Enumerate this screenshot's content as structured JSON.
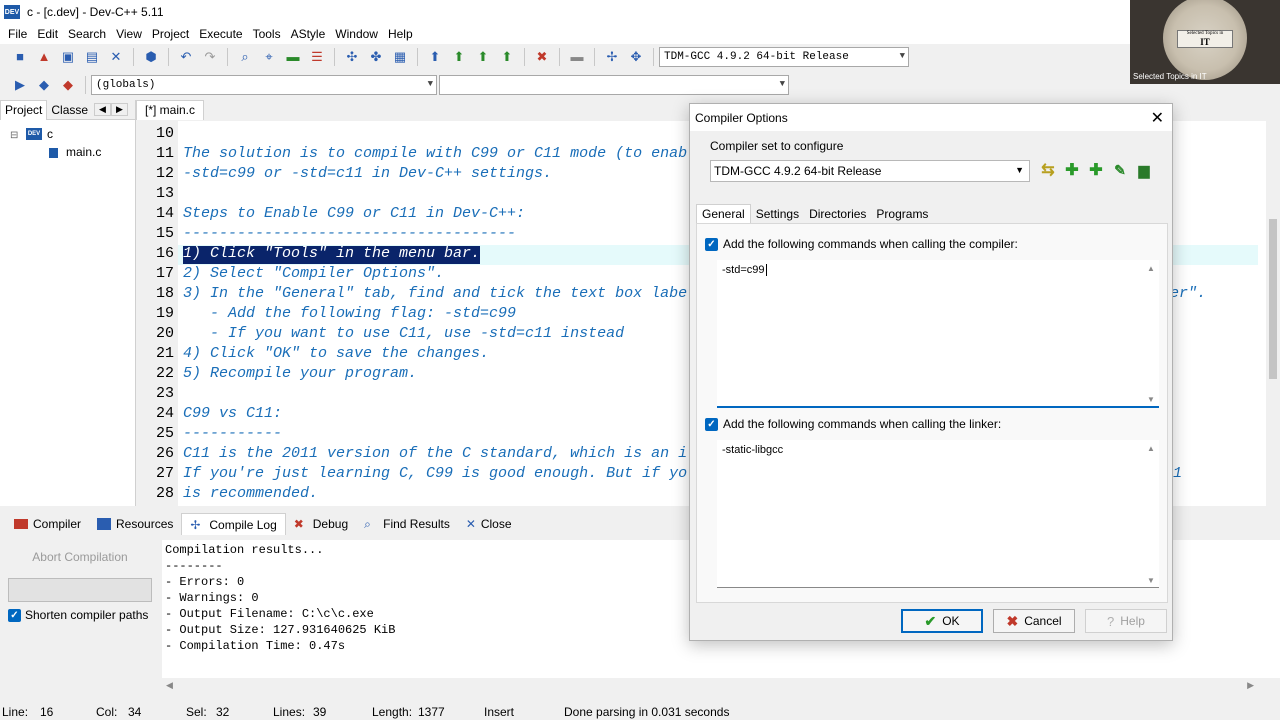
{
  "window": {
    "title": "c - [c.dev] - Dev-C++ 5.11",
    "app_icon_text": "DEV"
  },
  "webcam": {
    "banner_top": "Selected Topics in",
    "banner_main": "IT",
    "caption": "Selected Topics in IT"
  },
  "menu": [
    "File",
    "Edit",
    "Search",
    "View",
    "Project",
    "Execute",
    "Tools",
    "AStyle",
    "Window",
    "Help"
  ],
  "toolbar": {
    "compiler_select": "TDM-GCC 4.9.2 64-bit Release",
    "scope_select": "(globals)"
  },
  "left_panel": {
    "tabs": [
      "Project",
      "Classe"
    ],
    "tree": {
      "project": "c",
      "file": "main.c"
    }
  },
  "editor": {
    "tab_label": "[*] main.c",
    "lines": [
      {
        "n": "10",
        "text": ""
      },
      {
        "n": "11",
        "text": "The solution is to compile with C99 or C11 mode (to enab"
      },
      {
        "n": "12",
        "text": "-std=c99 or -std=c11 in Dev-C++ settings."
      },
      {
        "n": "13",
        "text": ""
      },
      {
        "n": "14",
        "text": "Steps to Enable C99 or C11 in Dev-C++:"
      },
      {
        "n": "15",
        "text": "-------------------------------------"
      },
      {
        "n": "16",
        "text": "1) Click \"Tools\" in the menu bar."
      },
      {
        "n": "17",
        "text": "2) Select \"Compiler Options\"."
      },
      {
        "n": "18",
        "text": "3) In the \"General\" tab, find and tick the text box labe"
      },
      {
        "n": "19",
        "text": "   - Add the following flag: -std=c99"
      },
      {
        "n": "20",
        "text": "   - If you want to use C11, use -std=c11 instead"
      },
      {
        "n": "21",
        "text": "4) Click \"OK\" to save the changes."
      },
      {
        "n": "22",
        "text": "5) Recompile your program."
      },
      {
        "n": "23",
        "text": ""
      },
      {
        "n": "24",
        "text": "C99 vs C11:"
      },
      {
        "n": "25",
        "text": "-----------"
      },
      {
        "n": "26",
        "text": "C11 is the 2011 version of the C standard, which is an i"
      },
      {
        "n": "27",
        "text": "If you're just learning C, C99 is good enough. But if yo"
      },
      {
        "n": "28",
        "text": "is recommended."
      }
    ],
    "overflow_18": "ler\".",
    "overflow_27": "C11"
  },
  "bottom_tabs": [
    "Compiler",
    "Resources",
    "Compile Log",
    "Debug",
    "Find Results",
    "Close"
  ],
  "compile": {
    "abort_label": "Abort Compilation",
    "shorten_label": "Shorten compiler paths",
    "log": [
      "Compilation results...",
      "--------",
      "- Errors: 0",
      "- Warnings: 0",
      "- Output Filename: C:\\c\\c.exe",
      "- Output Size: 127.931640625 KiB",
      "- Compilation Time: 0.47s"
    ]
  },
  "status": {
    "line": "Line:",
    "line_val": "16",
    "col": "Col:",
    "col_val": "34",
    "sel": "Sel:",
    "sel_val": "32",
    "lines": "Lines:",
    "lines_val": "39",
    "length": "Length:",
    "length_val": "1377",
    "mode": "Insert",
    "message": "Done parsing in 0.031 seconds"
  },
  "dialog": {
    "title": "Compiler Options",
    "set_label": "Compiler set to configure",
    "set_value": "TDM-GCC 4.9.2 64-bit Release",
    "tabs": [
      "General",
      "Settings",
      "Directories",
      "Programs"
    ],
    "compiler_cmd_label": "Add the following commands when calling the compiler:",
    "compiler_cmd_value": "-std=c99",
    "linker_cmd_label": "Add the following commands when calling the linker:",
    "linker_cmd_value": "-static-libgcc",
    "ok": "OK",
    "cancel": "Cancel",
    "help": "Help"
  }
}
